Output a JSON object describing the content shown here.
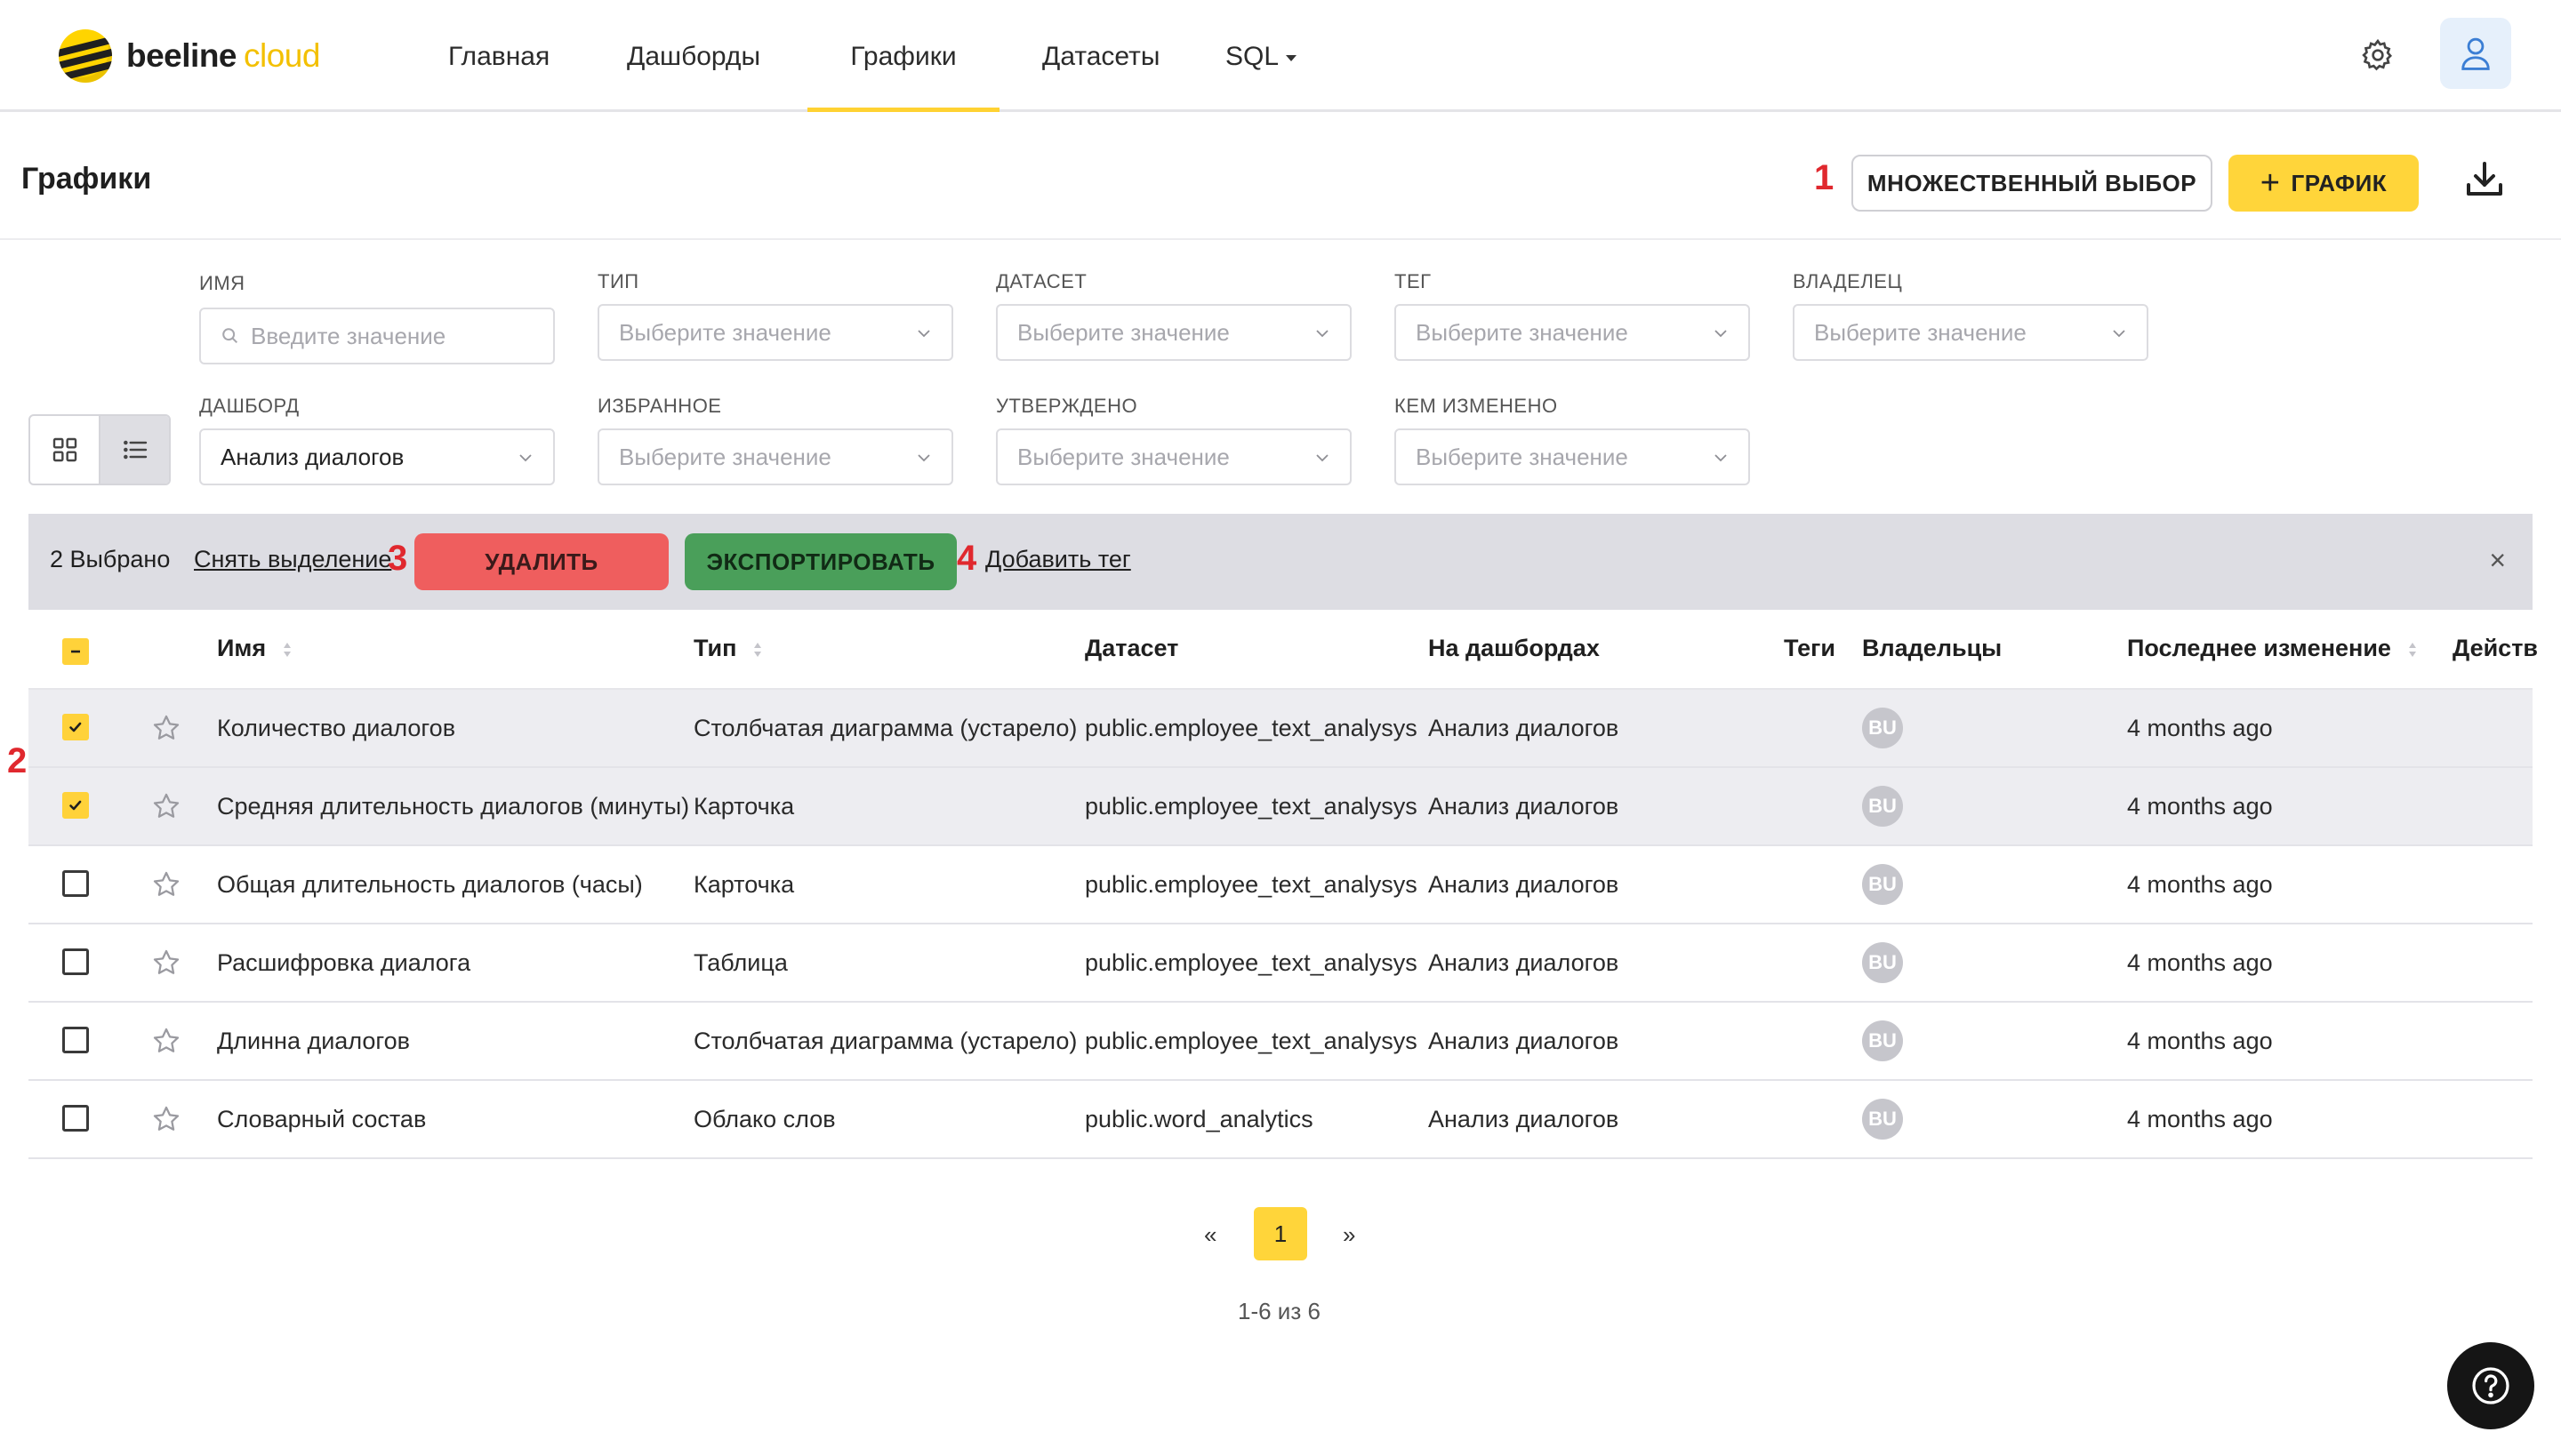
{
  "brand": {
    "word1": "beeline",
    "word2": "cloud"
  },
  "nav": {
    "items": [
      {
        "label": "Главная"
      },
      {
        "label": "Дашборды"
      },
      {
        "label": "Графики"
      },
      {
        "label": "Датасеты"
      },
      {
        "label": "SQL"
      }
    ],
    "active": "Графики"
  },
  "header": {
    "title": "Графики",
    "multi_select_label": "МНОЖЕСТВЕННЫЙ ВЫБОР",
    "add_chart_label": "ГРАФИК"
  },
  "annotations": {
    "m1": "1",
    "m2": "2",
    "m3": "3",
    "m4": "4"
  },
  "filters": {
    "name": {
      "label": "ИМЯ",
      "placeholder": "Введите значение"
    },
    "type": {
      "label": "ТИП",
      "placeholder": "Выберите значение"
    },
    "dataset": {
      "label": "ДАТАСЕТ",
      "placeholder": "Выберите значение"
    },
    "tag": {
      "label": "ТЕГ",
      "placeholder": "Выберите значение"
    },
    "owner": {
      "label": "ВЛАДЕЛЕЦ",
      "placeholder": "Выберите значение"
    },
    "dashboard": {
      "label": "ДАШБОРД",
      "value": "Анализ диалогов"
    },
    "favorite": {
      "label": "ИЗБРАННОЕ",
      "placeholder": "Выберите значение"
    },
    "approved": {
      "label": "УТВЕРЖДЕНО",
      "placeholder": "Выберите значение"
    },
    "changed_by": {
      "label": "КЕМ ИЗМЕНЕНО",
      "placeholder": "Выберите значение"
    }
  },
  "selection_bar": {
    "count_text": "2 Выбрано",
    "deselect_label": "Снять выделение",
    "delete_label": "УДАЛИТЬ",
    "export_label": "ЭКСПОРТИРОВАТЬ",
    "add_tag_label": "Добавить тег",
    "close_glyph": "×"
  },
  "table": {
    "columns": {
      "name": "Имя",
      "type": "Тип",
      "dataset": "Датасет",
      "dashboards": "На дашбордах",
      "tags": "Теги",
      "owners": "Владельцы",
      "modified": "Последнее изменение",
      "actions": "Действ"
    },
    "rows": [
      {
        "selected": true,
        "name": "Количество диалогов",
        "type": "Столбчатая диаграмма (устарело)",
        "dataset": "public.employee_text_analysys",
        "dashboard": "Анализ диалогов",
        "owner": "BU",
        "modified": "4 months ago"
      },
      {
        "selected": true,
        "name": "Средняя длительность диалогов (минуты)",
        "type": "Карточка",
        "dataset": "public.employee_text_analysys",
        "dashboard": "Анализ диалогов",
        "owner": "BU",
        "modified": "4 months ago"
      },
      {
        "selected": false,
        "name": "Общая длительность диалогов (часы)",
        "type": "Карточка",
        "dataset": "public.employee_text_analysys",
        "dashboard": "Анализ диалогов",
        "owner": "BU",
        "modified": "4 months ago"
      },
      {
        "selected": false,
        "name": "Расшифровка диалога",
        "type": "Таблица",
        "dataset": "public.employee_text_analysys",
        "dashboard": "Анализ диалогов",
        "owner": "BU",
        "modified": "4 months ago"
      },
      {
        "selected": false,
        "name": "Длинна диалогов",
        "type": "Столбчатая диаграмма (устарело)",
        "dataset": "public.employee_text_analysys",
        "dashboard": "Анализ диалогов",
        "owner": "BU",
        "modified": "4 months ago"
      },
      {
        "selected": false,
        "name": "Словарный состав",
        "type": "Облако слов",
        "dataset": "public.word_analytics",
        "dashboard": "Анализ диалогов",
        "owner": "BU",
        "modified": "4 months ago"
      }
    ]
  },
  "pagination": {
    "prev": "«",
    "current": "1",
    "next": "»",
    "info": "1-6 из 6"
  },
  "icons": {
    "settings": "gear-icon",
    "profile": "user-icon",
    "download": "download-icon",
    "help": "help-icon",
    "favorite": "star-icon",
    "grid_view": "grid-view-icon",
    "list_view": "list-view-icon",
    "search": "search-icon",
    "dropdown": "chevron-down-icon"
  },
  "colors": {
    "accent": "#ffd53a",
    "danger": "#ef5e5e",
    "success": "#4a9f5a",
    "annotation": "#e0282e",
    "selection_bar": "#dddde3"
  }
}
